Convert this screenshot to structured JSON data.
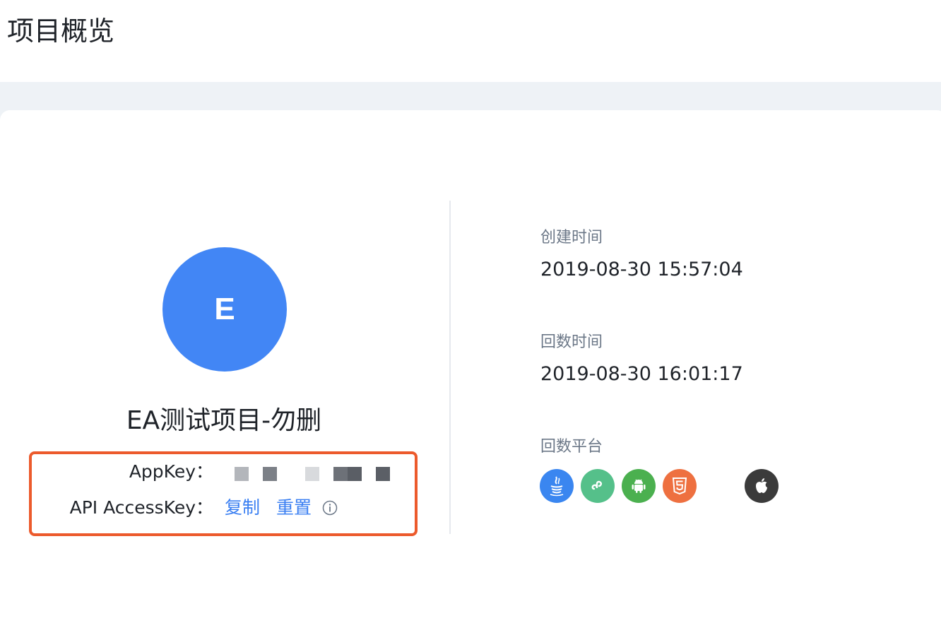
{
  "header": {
    "title": "项目概览"
  },
  "project": {
    "avatar_letter": "E",
    "avatar_color": "#4286f5",
    "name": "EA测试项目-勿删"
  },
  "keys": {
    "appkey_label": "AppKey：",
    "appkey_value": "masked",
    "api_label": "API AccessKey：",
    "copy_label": "复制",
    "reset_label": "重置",
    "highlight_color": "#ec5a2c",
    "link_color": "#3a7ff2"
  },
  "meta": {
    "created_label": "创建时间",
    "created_value": "2019-08-30 15:57:04",
    "callback_label": "回数时间",
    "callback_value": "2019-08-30 16:01:17",
    "platforms_label": "回数平台"
  },
  "platforms": [
    {
      "icon": "java-icon",
      "color": "#3a86f0"
    },
    {
      "icon": "mini-program-icon",
      "color": "#55c08a"
    },
    {
      "icon": "android-icon",
      "color": "#4bb04f"
    },
    {
      "icon": "html5-icon",
      "color": "#ee7040"
    },
    {
      "icon": "apple-icon",
      "color": "#3b3b3b"
    }
  ]
}
